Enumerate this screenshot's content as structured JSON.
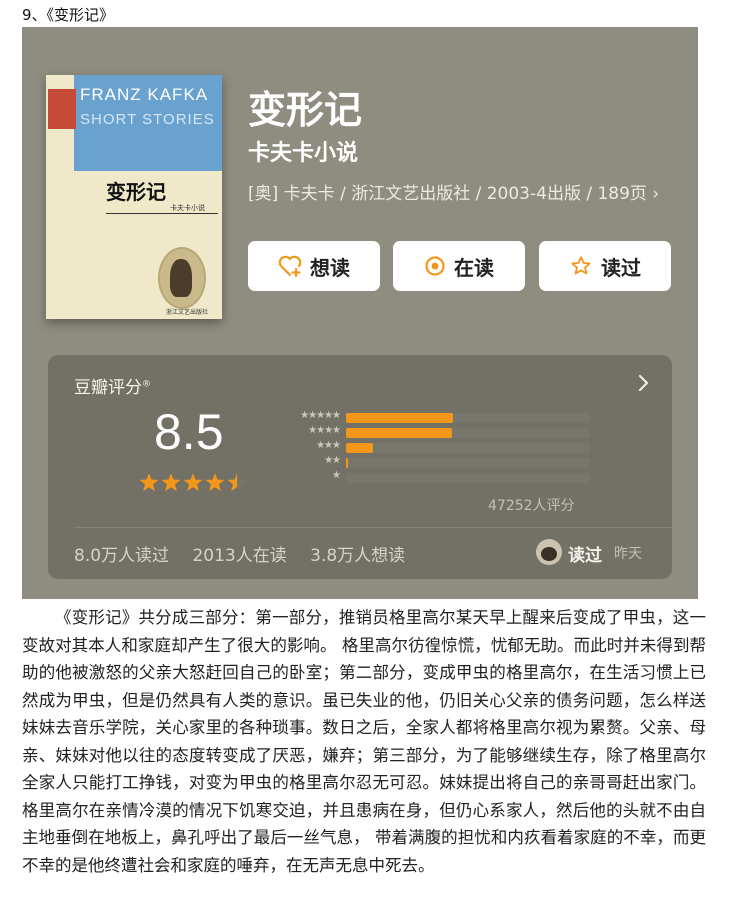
{
  "section": {
    "title": "9、《变形记》"
  },
  "cover": {
    "author_en": "FRANZ KAFKA",
    "series_en": "SHORT STORIES",
    "title_zh": "变形记",
    "subtitle_zh": "卡夫卡小说",
    "publisher_zh": "浙江文艺出版社"
  },
  "book": {
    "title": "变形记",
    "subtitle": "卡夫卡小说",
    "meta": "[奥] 卡夫卡 / 浙江文艺出版社 / 2003-4出版 / 189页 ›"
  },
  "buttons": {
    "want": "想读",
    "reading": "在读",
    "read": "读过"
  },
  "rating": {
    "label": "豆瓣评分",
    "reg_mark": "®",
    "score": "8.5",
    "star_value": 4.5,
    "histogram": [
      {
        "stars": "★★★★★",
        "fraction": 0.44
      },
      {
        "stars": "★★★★",
        "fraction": 0.435
      },
      {
        "stars": "★★★",
        "fraction": 0.11
      },
      {
        "stars": "★★",
        "fraction": 0.01
      },
      {
        "stars": "★",
        "fraction": 0.0
      }
    ],
    "count": "47252人评分"
  },
  "stats": {
    "read": "8.0万人读过",
    "reading": "2013人在读",
    "want": "3.8万人想读"
  },
  "user": {
    "status": "读过",
    "time": "昨天"
  },
  "colors": {
    "card_bg": "#8f8d7f",
    "accent_orange": "#f3971b",
    "button_bg": "#ffffff"
  },
  "description": "《变形记》共分成三部分：第一部分，推销员格里高尔某天早上醒来后变成了甲虫，这一变故对其本人和家庭却产生了很大的影响。 格里高尔彷徨惊慌，忧郁无助。而此时并未得到帮助的他被激怒的父亲大怒赶回自己的卧室；第二部分，变成甲虫的格里高尔，在生活习惯上已然成为甲虫，但是仍然具有人类的意识。虽已失业的他，仍旧关心父亲的债务问题，怎么样送妹妹去音乐学院，关心家里的各种琐事。数日之后，全家人都将格里高尔视为累赘。父亲、母亲、妹妹对他以往的态度转变成了厌恶，嫌弃；第三部分，为了能够继续生存，除了格里高尔全家人只能打工挣钱，对变为甲虫的格里高尔忍无可忍。妹妹提出将自己的亲哥哥赶出家门。格里高尔在亲情冷漠的情况下饥寒交迫，并且患病在身，但仍心系家人，然后他的头就不由自主地垂倒在地板上，鼻孔呼出了最后一丝气息， 带着满腹的担忧和内疚看着家庭的不幸，而更不幸的是他终遭社会和家庭的唾弃，在无声无息中死去。"
}
